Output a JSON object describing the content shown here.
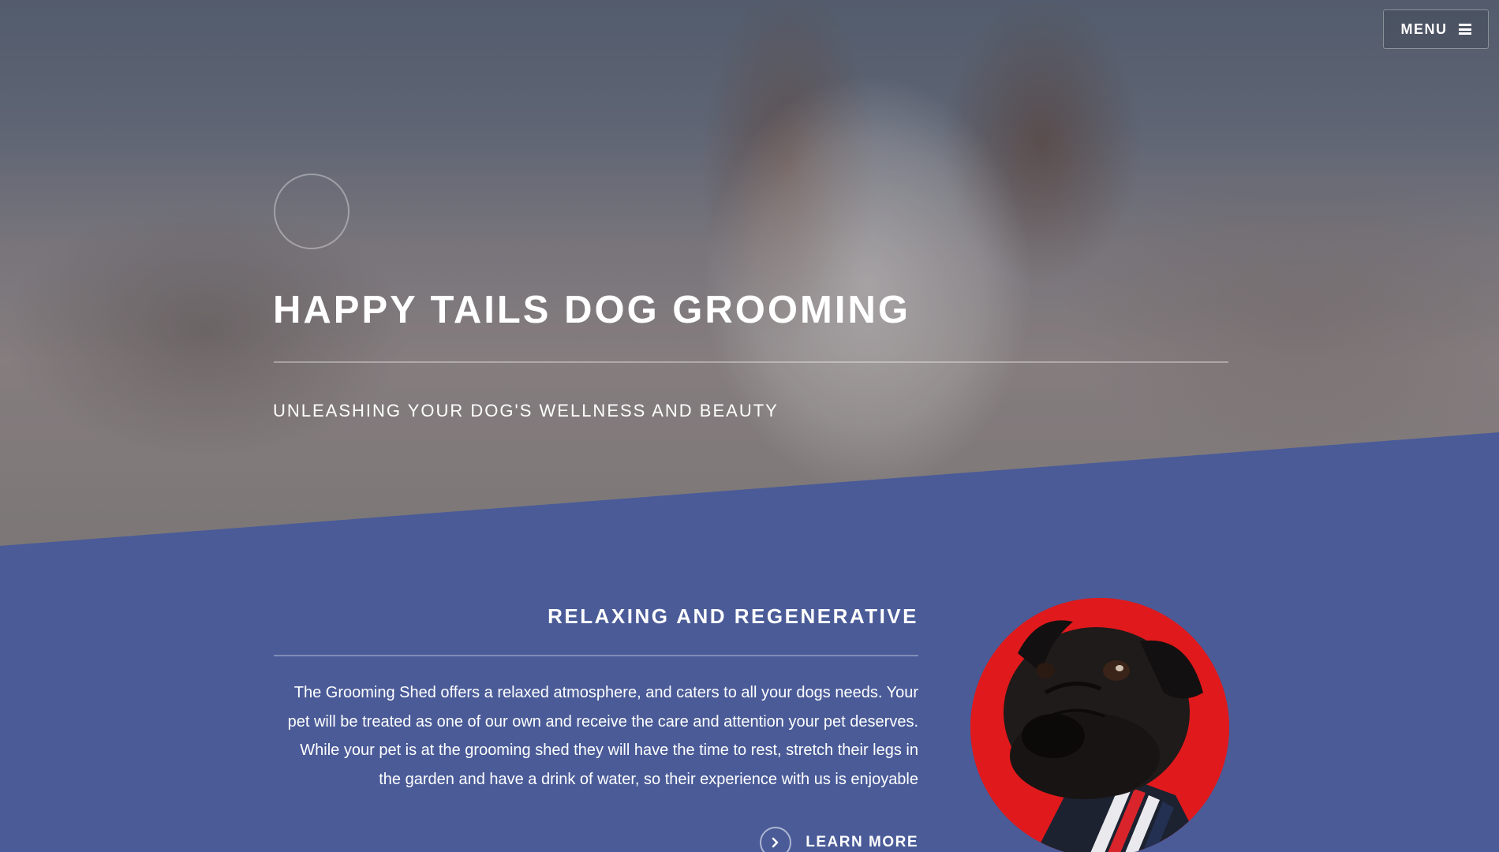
{
  "header": {
    "menu_label": "MENU"
  },
  "hero": {
    "title": "HAPPY TAILS DOG GROOMING",
    "subtitle": "UNLEASHING YOUR DOG'S WELLNESS AND BEAUTY",
    "background_image": "dog-photo"
  },
  "about": {
    "heading": "RELAXING AND REGENERATIVE",
    "body": "The Grooming Shed offers a relaxed atmosphere, and caters to all your dogs needs. Your pet will be treated as one of our own and receive the care and attention your pet deserves. While your pet is at the grooming shed they will have the time to rest, stretch their legs in the garden and have a drink of water, so their experience with us is enjoyable",
    "cta_label": "LEARN MORE",
    "image": "pug-photo"
  },
  "colors": {
    "section_blue": "#4a5b98",
    "pug_background_red": "#e0191c",
    "text_white": "#ffffff"
  },
  "icons": {
    "menu": "hamburger-icon",
    "cta": "chevron-right-icon"
  }
}
